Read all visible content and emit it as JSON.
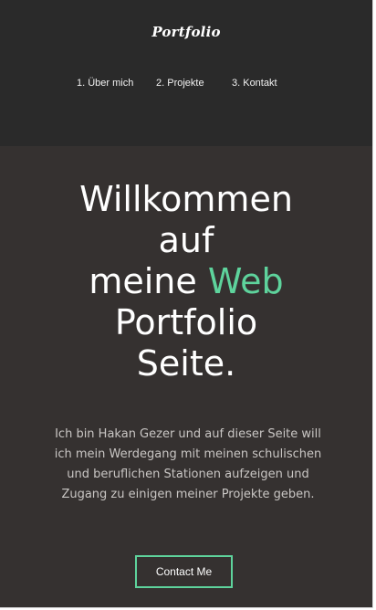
{
  "header": {
    "logo": "Portfolio",
    "nav": [
      {
        "label": "1. Über mich"
      },
      {
        "label": "2. Projekte"
      },
      {
        "label": "3. Kontakt"
      }
    ]
  },
  "hero": {
    "line1": "Willkommen",
    "line2": "auf",
    "line3_prefix": "meine ",
    "line3_accent": "Web",
    "line4": "Portfolio",
    "line5": "Seite."
  },
  "intro": {
    "text": "Ich bin Hakan Gezer und auf dieser Seite will ich mein Werdegang mit meinen schulischen und beruflichen Stationen aufzeigen und Zugang zu einigen meiner Projekte geben."
  },
  "cta": {
    "label": "Contact Me"
  },
  "colors": {
    "background": "#353130",
    "header_background": "#2a2a2a",
    "accent": "#5ed39c",
    "text": "#ffffff",
    "muted_text": "#c9c6c4"
  }
}
